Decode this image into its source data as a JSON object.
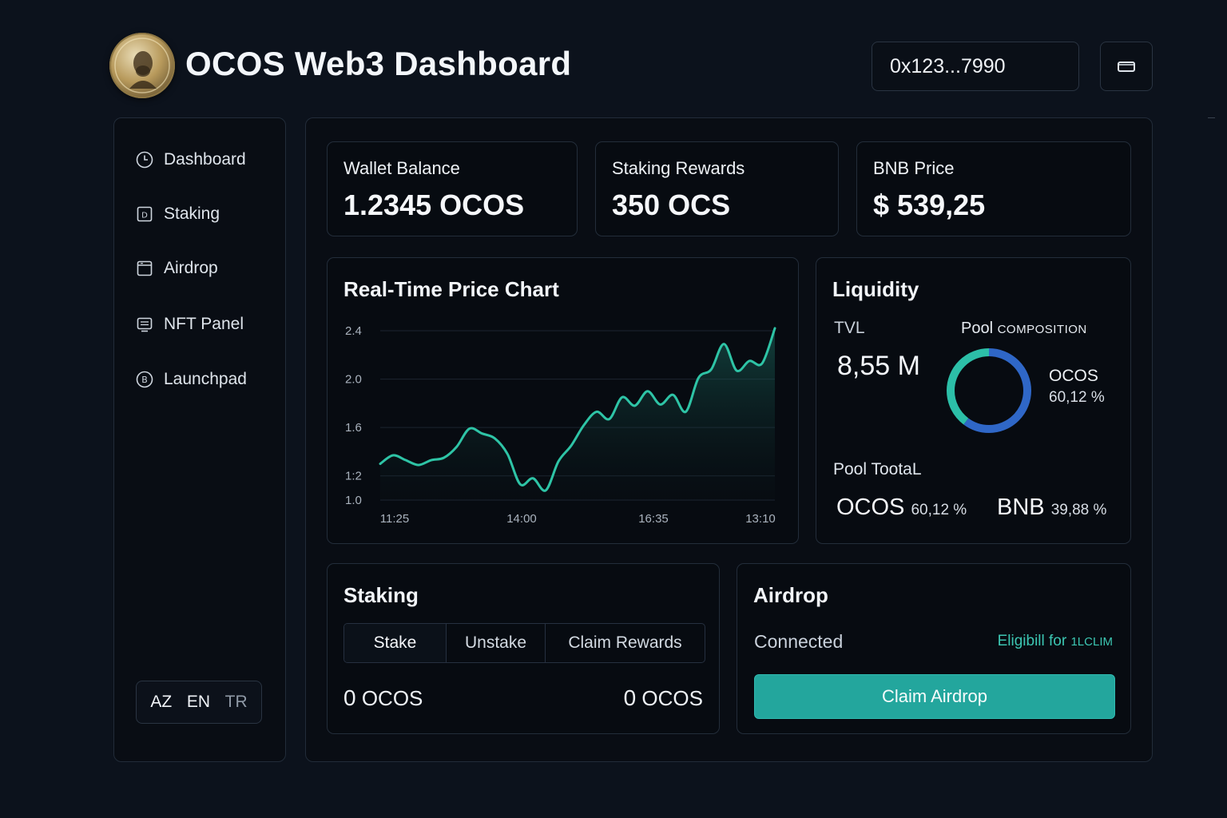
{
  "header": {
    "title": "OCOS Web3 Dashboard",
    "wallet_address": "0x123...7990",
    "logo_icon": "coin-portrait-logo",
    "wallet_icon": "wallet-icon"
  },
  "sidebar": {
    "items": [
      {
        "label": "Dashboard",
        "icon": "clock-icon"
      },
      {
        "label": "Staking",
        "icon": "staking-square-icon"
      },
      {
        "label": "Airdrop",
        "icon": "airdrop-box-icon"
      },
      {
        "label": "NFT Panel",
        "icon": "nft-panel-icon"
      },
      {
        "label": "Launchpad",
        "icon": "launchpad-coin-icon"
      }
    ],
    "languages": [
      "AZ",
      "EN",
      "TR"
    ]
  },
  "stats": [
    {
      "label": "Wallet Balance",
      "value": "1.2345 OCOS"
    },
    {
      "label": "Staking Rewards",
      "value": "350 OCS"
    },
    {
      "label": "BNB Price",
      "value": "$ 539,25"
    }
  ],
  "price_chart": {
    "title": "Real-Time Price Chart",
    "line_color": "#2ec4a6"
  },
  "chart_data": {
    "type": "area",
    "title": "Real-Time Price Chart",
    "xlabel": "",
    "ylabel": "",
    "y_ticks": [
      "2.4",
      "2.0",
      "1.6",
      "1:2",
      "1.0"
    ],
    "y_tick_values": [
      2.4,
      2.0,
      1.6,
      1.2,
      1.0
    ],
    "x_ticks": [
      "11:25",
      "14:00",
      "16:35",
      "13:10"
    ],
    "ylim": [
      1.0,
      2.4
    ],
    "grid": true,
    "legend": "none",
    "series": [
      {
        "values": [
          1.3,
          1.37,
          1.33,
          1.29,
          1.33,
          1.35,
          1.44,
          1.59,
          1.55,
          1.51,
          1.38,
          1.13,
          1.18,
          1.08,
          1.32,
          1.45,
          1.62,
          1.73,
          1.67,
          1.85,
          1.78,
          1.9,
          1.79,
          1.87,
          1.73,
          2.01,
          2.08,
          2.29,
          2.07,
          2.15,
          2.13,
          2.42
        ]
      }
    ]
  },
  "liquidity": {
    "title": "Liquidity",
    "tvl_label": "TVL",
    "tvl_value": "8,55 M",
    "pool_composition_label": "Pool",
    "pool_composition_sub": "COMPOSITION",
    "legend_name": "OCOS",
    "legend_pct": "60,12 %",
    "pool_total_label": "Pool TootaL",
    "token_a": {
      "name": "OCOS",
      "pct": "60,12 %"
    },
    "token_b": {
      "name": "BNB",
      "pct": "39,88 %"
    },
    "donut": {
      "ocos_share": 60.12,
      "bnb_share": 39.88,
      "ocos_color": "#2f67c7",
      "bnb_color": "#2cbfa8"
    }
  },
  "staking": {
    "title": "Staking",
    "tabs": [
      "Stake",
      "Unstake",
      "Claim Rewards"
    ],
    "left_amount_num": "0",
    "left_amount_unit": "OCOS",
    "right_amount_num": "0",
    "right_amount_unit": "OCOS"
  },
  "airdrop": {
    "title": "Airdrop",
    "status": "Connected",
    "eligible_text": "Eligibill for",
    "eligible_sub": "1LCLIM",
    "claim_button": "Claim Airdrop"
  },
  "colors": {
    "background": "#0c121c",
    "accent_teal": "#23a69d",
    "chart_line": "#2ec4a6",
    "donut_blue": "#2f67c7"
  }
}
